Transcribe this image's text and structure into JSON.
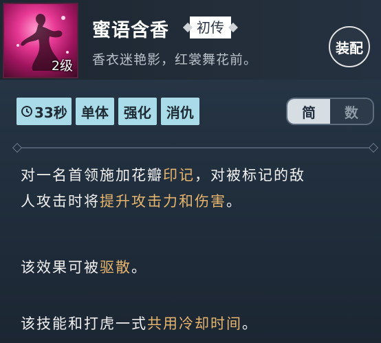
{
  "skill": {
    "name": "蜜语含香",
    "tag": "初传",
    "subtitle": "香衣迷艳影，红裳舞花前。",
    "level": "2级",
    "equip_label": "装配",
    "icon": "dancer-silhouette-icon"
  },
  "attributes": {
    "cooldown": "33秒",
    "items": [
      "单体",
      "强化",
      "消仇"
    ]
  },
  "view_toggle": {
    "options": [
      "简",
      "数"
    ],
    "selected": "简"
  },
  "description": {
    "p1_line1_a": "对一名首领施加花瓣",
    "p1_line1_hl": "印记",
    "p1_line1_b": "，对被标记的敌",
    "p1_line2_a": "人攻击时将",
    "p1_line2_hl": "提升攻击力和伤害",
    "p1_line2_b": "。",
    "p2_a": "该效果可被",
    "p2_hl": "驱散",
    "p2_b": "。",
    "p3_a": "该技能和打虎一式",
    "p3_hl": "共用冷却时间",
    "p3_b": "。"
  },
  "colors": {
    "highlight": "#e6b56e",
    "chip_bg": "#a9dce8",
    "panel_bg": "#22303f"
  }
}
